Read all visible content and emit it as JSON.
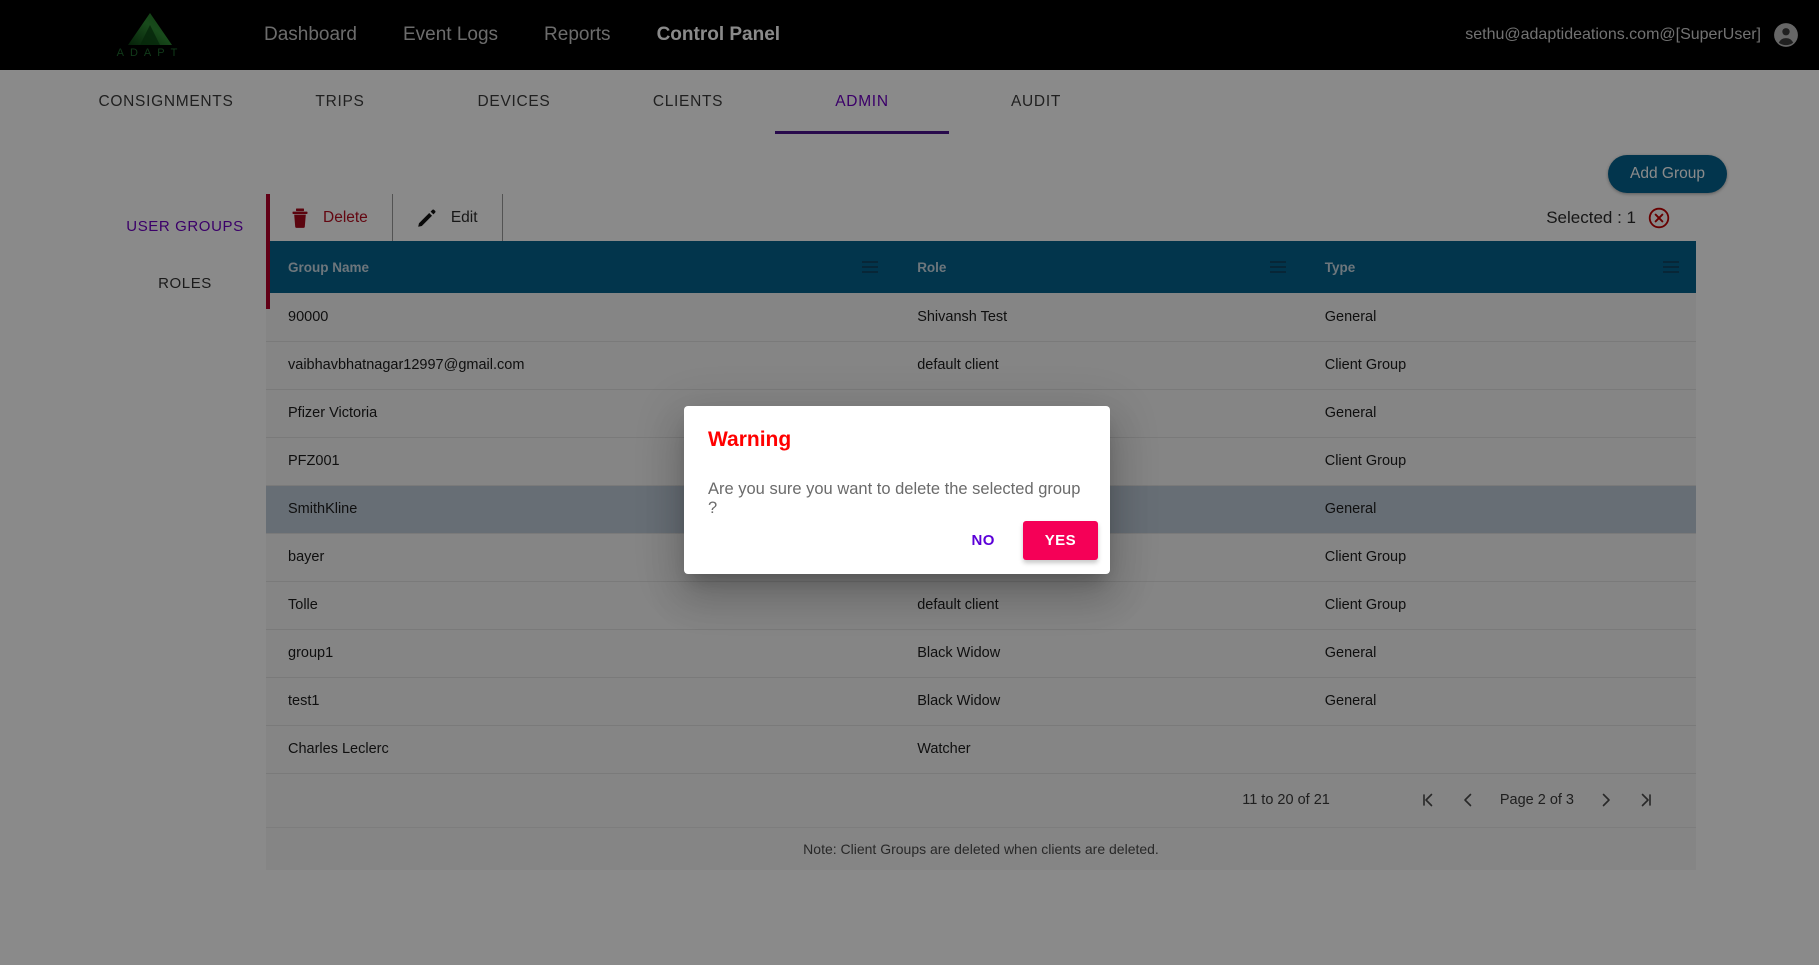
{
  "topbar": {
    "logo_word": "ADAPT",
    "nav": [
      {
        "label": "Dashboard",
        "active": false
      },
      {
        "label": "Event Logs",
        "active": false
      },
      {
        "label": "Reports",
        "active": false
      },
      {
        "label": "Control Panel",
        "active": true
      }
    ],
    "user": "sethu@adaptideations.com@[SuperUser]"
  },
  "tabs": [
    {
      "label": "CONSIGNMENTS",
      "active": false
    },
    {
      "label": "TRIPS",
      "active": false
    },
    {
      "label": "DEVICES",
      "active": false
    },
    {
      "label": "CLIENTS",
      "active": false
    },
    {
      "label": "ADMIN",
      "active": true
    },
    {
      "label": "AUDIT",
      "active": false
    }
  ],
  "actions": {
    "add_group": "Add Group"
  },
  "sidenav": [
    {
      "label": "USER GROUPS",
      "active": true
    },
    {
      "label": "ROLES",
      "active": false
    }
  ],
  "toolbar": {
    "delete_label": "Delete",
    "edit_label": "Edit",
    "selected_label": "Selected : 1"
  },
  "table": {
    "columns": [
      "Group Name",
      "Role",
      "Type"
    ],
    "rows": [
      {
        "name": "90000",
        "role": "Shivansh Test",
        "type": "General",
        "selected": false
      },
      {
        "name": "vaibhavbhatnagar12997@gmail.com",
        "role": "default client",
        "type": "Client Group",
        "selected": false
      },
      {
        "name": "Pfizer Victoria",
        "role": "",
        "type": "General",
        "selected": false
      },
      {
        "name": "PFZ001",
        "role": "",
        "type": "Client Group",
        "selected": false
      },
      {
        "name": "SmithKline",
        "role": "",
        "type": "General",
        "selected": true
      },
      {
        "name": "bayer",
        "role": "",
        "type": "Client Group",
        "selected": false
      },
      {
        "name": "Tolle",
        "role": "default client",
        "type": "Client Group",
        "selected": false
      },
      {
        "name": "group1",
        "role": "Black Widow",
        "type": "General",
        "selected": false
      },
      {
        "name": "test1",
        "role": "Black Widow",
        "type": "General",
        "selected": false
      },
      {
        "name": "Charles Leclerc",
        "role": "Watcher",
        "type": "",
        "selected": false
      }
    ]
  },
  "pagination": {
    "range": "11 to 20 of 21",
    "page_label": "Page 2 of 3",
    "first_icon": "first-page-icon",
    "prev_icon": "previous-page-icon",
    "next_icon": "next-page-icon",
    "last_icon": "last-page-icon"
  },
  "footer_note": "Note: Client Groups are deleted when clients are deleted.",
  "dialog": {
    "title": "Warning",
    "message": "Are you sure you want to delete the selected group ?",
    "no_label": "NO",
    "yes_label": "YES"
  },
  "colors": {
    "topbar_bg": "#000000",
    "accent_purple": "#6d00c2",
    "table_header_bg": "#04628d",
    "delete_red": "#b80d21",
    "warning_red": "#ff0000",
    "yes_pink": "#f50057",
    "selected_row": "#becbd9",
    "add_group_blue": "#04638f",
    "red_strip": "#b3002a"
  }
}
